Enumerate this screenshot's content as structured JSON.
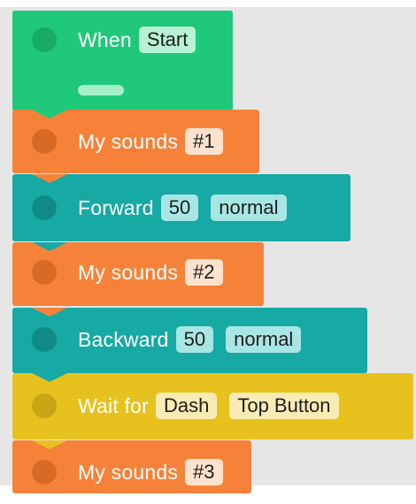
{
  "blocks": {
    "when": {
      "label": "When",
      "event": "Start"
    },
    "sound1": {
      "label": "My sounds",
      "value": "#1"
    },
    "forward": {
      "label": "Forward",
      "distance": "50",
      "speed": "normal"
    },
    "sound2": {
      "label": "My sounds",
      "value": "#2"
    },
    "backward": {
      "label": "Backward",
      "distance": "50",
      "speed": "normal"
    },
    "wait": {
      "label": "Wait for",
      "target": "Dash",
      "sensor": "Top Button"
    },
    "sound3": {
      "label": "My sounds",
      "value": "#3"
    }
  },
  "colors": {
    "event": "#1fc87a",
    "sound": "#f6823a",
    "drive": "#17a9a4",
    "control": "#e7c21f",
    "workspace": "#e6e6e6"
  }
}
